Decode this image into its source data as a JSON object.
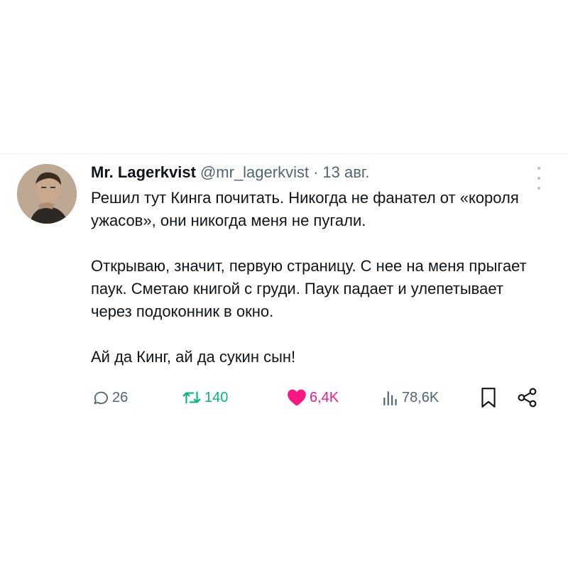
{
  "author": {
    "name": "Mr. Lagerkvist",
    "handle": "@mr_lagerkvist",
    "separator": "·",
    "date": "13 авг."
  },
  "tweet": {
    "paragraphs": [
      "Решил тут Кинга почитать. Никогда не фанател от «короля ужасов», они никогда меня не пугали.",
      "Открываю, значит, первую страницу. С нее на меня прыгает паук. Сметаю книгой с груди. Паук падает и улепетывает через подоконник в окно.",
      "Ай да Кинг, ай да сукин сын!"
    ]
  },
  "actions": {
    "replies": "26",
    "retweets": "140",
    "likes": "6,4K",
    "views": "78,6K"
  },
  "icons": {
    "reply": "reply-icon",
    "retweet": "retweet-icon",
    "like": "heart-icon",
    "views": "views-icon",
    "bookmark": "bookmark-icon",
    "share": "share-icon",
    "more": "more-icon"
  },
  "colors": {
    "text": "#0f1419",
    "secondary": "#536471",
    "retweet": "#00ba7c",
    "like": "#f91880",
    "divider": "#eff3f4"
  }
}
